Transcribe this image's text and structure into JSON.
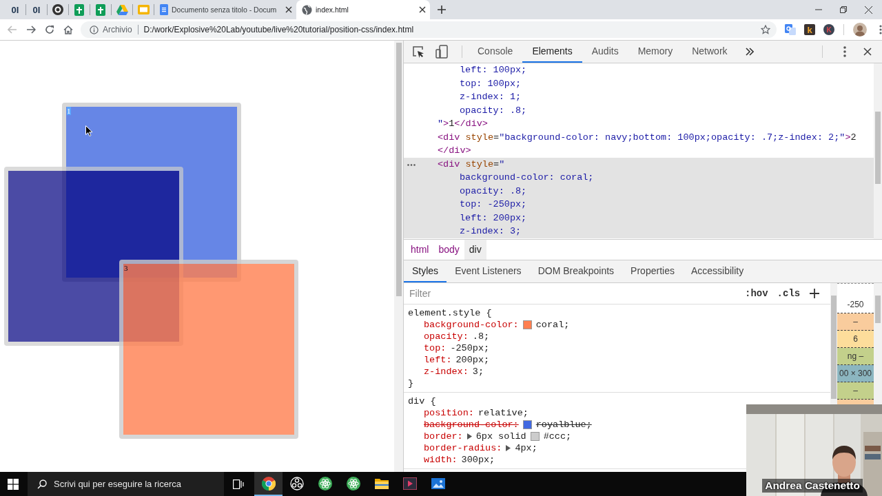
{
  "browser": {
    "pinned_tabs": [
      {
        "kind": "letters",
        "glyph": "0I"
      },
      {
        "kind": "letters",
        "glyph": "0I"
      },
      {
        "kind": "ring"
      },
      {
        "kind": "sheet"
      },
      {
        "kind": "sheet"
      },
      {
        "kind": "triangle"
      },
      {
        "kind": "slide"
      }
    ],
    "tabs": [
      {
        "kind": "document",
        "title": "Documento senza titolo - Docum",
        "selected": false
      },
      {
        "kind": "globe",
        "title": "index.html",
        "selected": true
      }
    ],
    "back": {
      "disabled": true
    },
    "forward": {
      "disabled": false
    },
    "address": {
      "security_label": "Archivio",
      "url": "D:/work/Explosive%20Lab/youtube/live%20tutorial/position-css/index.html"
    },
    "extensions": [
      {
        "kind": "translate"
      },
      {
        "kind": "badge",
        "glyph": "k"
      },
      {
        "kind": "round",
        "glyph": "K"
      }
    ]
  },
  "page": {
    "squares": [
      {
        "kind": "square",
        "label": "1",
        "label_selected": true
      },
      {
        "kind": "square"
      },
      {
        "kind": "square",
        "label": "3",
        "label_selected": false
      }
    ]
  },
  "devtools": {
    "tabs": [
      {
        "label": "Console",
        "selected": false
      },
      {
        "label": "Elements",
        "selected": true
      },
      {
        "label": "Audits",
        "selected": false
      },
      {
        "label": "Memory",
        "selected": false
      },
      {
        "label": "Network",
        "selected": false
      }
    ],
    "code_lines": [
      {
        "kind": "style",
        "highlighted": false,
        "marked": false,
        "segments": [
          {
            "kind": "value",
            "text": "left: 100px;"
          }
        ]
      },
      {
        "kind": "style",
        "highlighted": false,
        "marked": false,
        "segments": [
          {
            "kind": "value",
            "text": "top: 100px;"
          }
        ]
      },
      {
        "kind": "style",
        "highlighted": false,
        "marked": false,
        "segments": [
          {
            "kind": "value",
            "text": "z-index: 1;"
          }
        ]
      },
      {
        "kind": "style",
        "highlighted": false,
        "marked": false,
        "segments": [
          {
            "kind": "value",
            "text": "opacity: .8;"
          }
        ]
      },
      {
        "kind": "markup",
        "highlighted": false,
        "marked": false,
        "segments": [
          {
            "kind": "value",
            "text": "\""
          },
          {
            "kind": "tag",
            "text": ">"
          },
          {
            "kind": "text",
            "text": "1"
          },
          {
            "kind": "tag",
            "text": "</div>"
          }
        ]
      },
      {
        "kind": "markup",
        "highlighted": false,
        "marked": false,
        "segments": [
          {
            "kind": "tag",
            "text": "<div"
          },
          {
            "kind": "attr",
            "text": " style"
          },
          {
            "kind": "text",
            "text": "="
          },
          {
            "kind": "value",
            "text": "\"background-color: navy;bottom: 100px;opacity: .7;z-index: 2;\""
          },
          {
            "kind": "tag",
            "text": ">"
          },
          {
            "kind": "text",
            "text": "2"
          }
        ]
      },
      {
        "kind": "markup",
        "highlighted": false,
        "marked": false,
        "segments": [
          {
            "kind": "tag",
            "text": "</div>"
          }
        ]
      },
      {
        "kind": "markup",
        "highlighted": true,
        "marked": true,
        "segments": [
          {
            "kind": "tag",
            "text": "<div"
          },
          {
            "kind": "attr",
            "text": " style"
          },
          {
            "kind": "text",
            "text": "="
          },
          {
            "kind": "value",
            "text": "\""
          }
        ]
      },
      {
        "kind": "style",
        "highlighted": true,
        "marked": false,
        "segments": [
          {
            "kind": "value",
            "text": "background-color: coral;"
          }
        ]
      },
      {
        "kind": "style",
        "highlighted": true,
        "marked": false,
        "segments": [
          {
            "kind": "value",
            "text": "opacity: .8;"
          }
        ]
      },
      {
        "kind": "style",
        "highlighted": true,
        "marked": false,
        "segments": [
          {
            "kind": "value",
            "text": "top: -250px;"
          }
        ]
      },
      {
        "kind": "style",
        "highlighted": true,
        "marked": false,
        "segments": [
          {
            "kind": "value",
            "text": "left: 200px;"
          }
        ]
      },
      {
        "kind": "style",
        "highlighted": true,
        "marked": false,
        "segments": [
          {
            "kind": "value",
            "text": "z-index: 3;"
          }
        ]
      }
    ],
    "breadcrumb": [
      {
        "label": "html",
        "selected": false
      },
      {
        "label": "body",
        "selected": false
      },
      {
        "label": "div",
        "selected": true
      }
    ],
    "subtabs": [
      {
        "label": "Styles",
        "selected": true
      },
      {
        "label": "Event Listeners",
        "selected": false
      },
      {
        "label": "DOM Breakpoints",
        "selected": false
      },
      {
        "label": "Properties",
        "selected": false
      },
      {
        "label": "Accessibility",
        "selected": false
      }
    ],
    "filter": {
      "placeholder": "Filter"
    },
    "filter_buttons": [
      ":hov",
      ".cls"
    ],
    "rules": [
      {
        "selector": "element.style {",
        "close": "}",
        "declarations": [
          {
            "property": "background-color:",
            "color": "#ff7f50",
            "value": "coral;",
            "struck": false,
            "expandable": false
          },
          {
            "property": "opacity:",
            "value": ".8;",
            "struck": false,
            "expandable": false
          },
          {
            "property": "top:",
            "value": "-250px;",
            "struck": false,
            "expandable": false
          },
          {
            "property": "left:",
            "value": "200px;",
            "struck": false,
            "expandable": false
          },
          {
            "property": "z-index:",
            "value": "3;",
            "struck": false,
            "expandable": false
          }
        ]
      },
      {
        "selector": "div {",
        "declarations": [
          {
            "property": "position:",
            "value": "relative;",
            "struck": false,
            "expandable": false
          },
          {
            "property": "background-color:",
            "color": "#4169e1",
            "value": "royalblue;",
            "struck": true,
            "expandable": false
          },
          {
            "property": "border:",
            "pre": "6px solid",
            "color": "#cccccc",
            "value": "#ccc;",
            "struck": false,
            "expandable": true
          },
          {
            "property": "border-radius:",
            "value": "4px;",
            "struck": false,
            "expandable": true
          },
          {
            "property": "width:",
            "value": "300px;",
            "struck": false,
            "expandable": false
          }
        ]
      }
    ],
    "box_model": [
      {
        "text": "-250",
        "color": "#ffffff"
      },
      {
        "text": "–",
        "color": "#f9cc9d"
      },
      {
        "text": "6",
        "color": "#fddd9b"
      },
      {
        "text": "ng –",
        "color": "#c3d08b"
      },
      {
        "text": "00 × 300",
        "color": "#8cb6c0"
      },
      {
        "text": "–",
        "color": "#c3d08b"
      },
      {
        "color": "#f9cc9d"
      }
    ]
  },
  "webcam": {
    "kind": "picture",
    "caption": "Andrea Castenetto"
  },
  "taskbar": {
    "search_placeholder": "Scrivi qui per eseguire la ricerca",
    "apps": [
      {
        "kind": "chrome",
        "selected": true
      },
      {
        "kind": "obs",
        "selected": false
      },
      {
        "kind": "atom",
        "selected": false
      },
      {
        "kind": "atom",
        "selected": false
      },
      {
        "kind": "folder",
        "selected": false
      },
      {
        "kind": "video",
        "selected": false
      },
      {
        "kind": "photos",
        "selected": false
      }
    ]
  }
}
